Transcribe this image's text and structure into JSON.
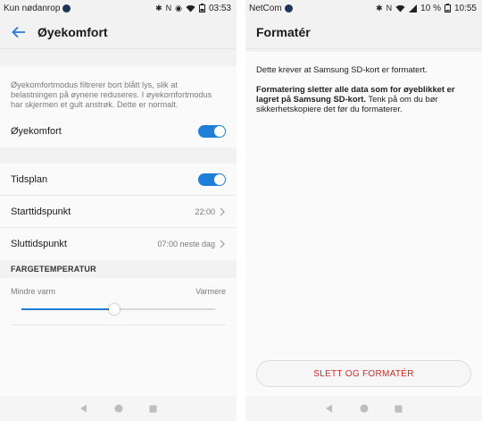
{
  "left": {
    "statusbar": {
      "carrier": "Kun nødanrop",
      "time": "03:53"
    },
    "appbar": {
      "title": "Øyekomfort"
    },
    "description": "Øyekomfortmodus filtrerer bort blått lys, slik at belastningen på øynene reduseres. I øyekomfortmodus har skjermen et gult anstrøk. Dette er normalt.",
    "eye_comfort": {
      "label": "Øyekomfort",
      "enabled": true
    },
    "schedule": {
      "label": "Tidsplan",
      "enabled": true
    },
    "start_time": {
      "label": "Starttidspunkt",
      "value": "22:00"
    },
    "end_time": {
      "label": "Sluttidspunkt",
      "value": "07:00 neste dag"
    },
    "color_temp": {
      "section": "FARGETEMPERATUR",
      "min_label": "Mindre varm",
      "max_label": "Varmere",
      "value": 0.48
    }
  },
  "right": {
    "statusbar": {
      "carrier": "NetCom",
      "battery": "10 %",
      "time": "10:55"
    },
    "appbar": {
      "title": "Formatér"
    },
    "intro": "Dette krever at Samsung SD-kort er formatert.",
    "warning_bold": "Formatering sletter alle data som for øyeblikket er lagret på Samsung SD-kort.",
    "warning_rest": " Tenk på om du bør sikkerhetskopiere det før du formaterer.",
    "action_label": "SLETT OG FORMATÉR"
  },
  "colors": {
    "accent": "#1e7ed8",
    "danger": "#d8261f"
  }
}
